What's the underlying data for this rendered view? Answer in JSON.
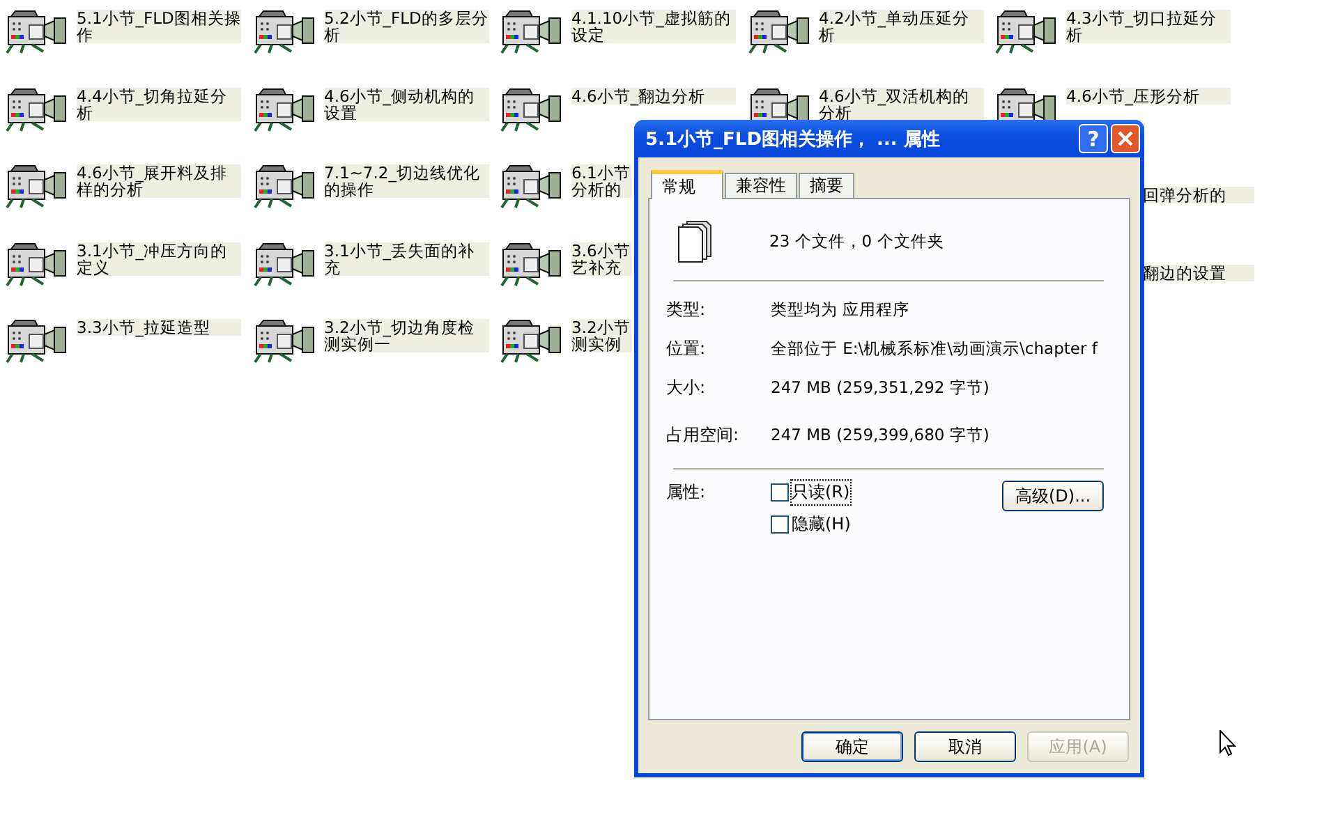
{
  "files": [
    {
      "kind": "file",
      "label": "5.1小节_FLD图相关操作"
    },
    {
      "kind": "file",
      "label": "5.2小节_FLD的多层分析"
    },
    {
      "kind": "file",
      "label": "4.1.10小节_虚拟筋的设定"
    },
    {
      "kind": "file",
      "label": "4.2小节_单动压延分析"
    },
    {
      "kind": "file",
      "label": "4.3小节_切口拉延分析"
    },
    {
      "kind": "file",
      "label": "4.4小节_切角拉延分析"
    },
    {
      "kind": "file",
      "label": "4.6小节_侧动机构的设置"
    },
    {
      "kind": "file",
      "label": "4.6小节_翻边分析"
    },
    {
      "kind": "file",
      "label": "4.6小节_双活机构的分析"
    },
    {
      "kind": "file",
      "label": "4.6小节_压形分析"
    },
    {
      "kind": "file",
      "label": "4.6小节_展开料及排样的分析"
    },
    {
      "kind": "file",
      "label": "7.1~7.2_切边线优化的操作"
    },
    {
      "kind": "clipped",
      "label": "6.1小节分析的"
    },
    {
      "kind": "tail",
      "label": "回弹分析的"
    },
    {
      "kind": "file",
      "label": "3.1小节_冲压方向的定义"
    },
    {
      "kind": "file",
      "label": "3.1小节_丢失面的补充"
    },
    {
      "kind": "clipped",
      "label": "3.6小节艺补充"
    },
    {
      "kind": "tail",
      "label": "翻边的设置"
    },
    {
      "kind": "file",
      "label": "3.3小节_拉延造型"
    },
    {
      "kind": "file",
      "label": "3.2小节_切边角度检测实例一"
    },
    {
      "kind": "clipped",
      "label": "3.2小节测实例"
    }
  ],
  "dialog": {
    "title": "5.1小节_FLD图相关操作， ... 属性",
    "help_glyph": "?",
    "tabs": [
      {
        "label": "常规",
        "selected": true
      },
      {
        "label": "兼容性",
        "selected": false
      },
      {
        "label": "摘要",
        "selected": false
      }
    ],
    "summary": "23 个文件，0 个文件夹",
    "details": [
      {
        "label": "类型:",
        "value": "类型均为 应用程序"
      },
      {
        "label": "位置:",
        "value": "全部位于 E:\\机械系标准\\动画演示\\chapter f"
      },
      {
        "label": "大小:",
        "value": "247 MB (259,351,292 字节)"
      }
    ],
    "size_on_disk": {
      "label": "占用空间:",
      "value": "247 MB (259,399,680 字节)"
    },
    "attributes_label": "属性:",
    "checkboxes": [
      {
        "label": "只读(R)",
        "checked": false,
        "focused": true
      },
      {
        "label": "隐藏(H)",
        "checked": false,
        "focused": false
      }
    ],
    "advanced_button": "高级(D)...",
    "buttons": [
      {
        "label": "确定",
        "disabled": false,
        "default": true
      },
      {
        "label": "取消",
        "disabled": false,
        "default": false
      },
      {
        "label": "应用(A)",
        "disabled": true,
        "default": false
      }
    ]
  }
}
